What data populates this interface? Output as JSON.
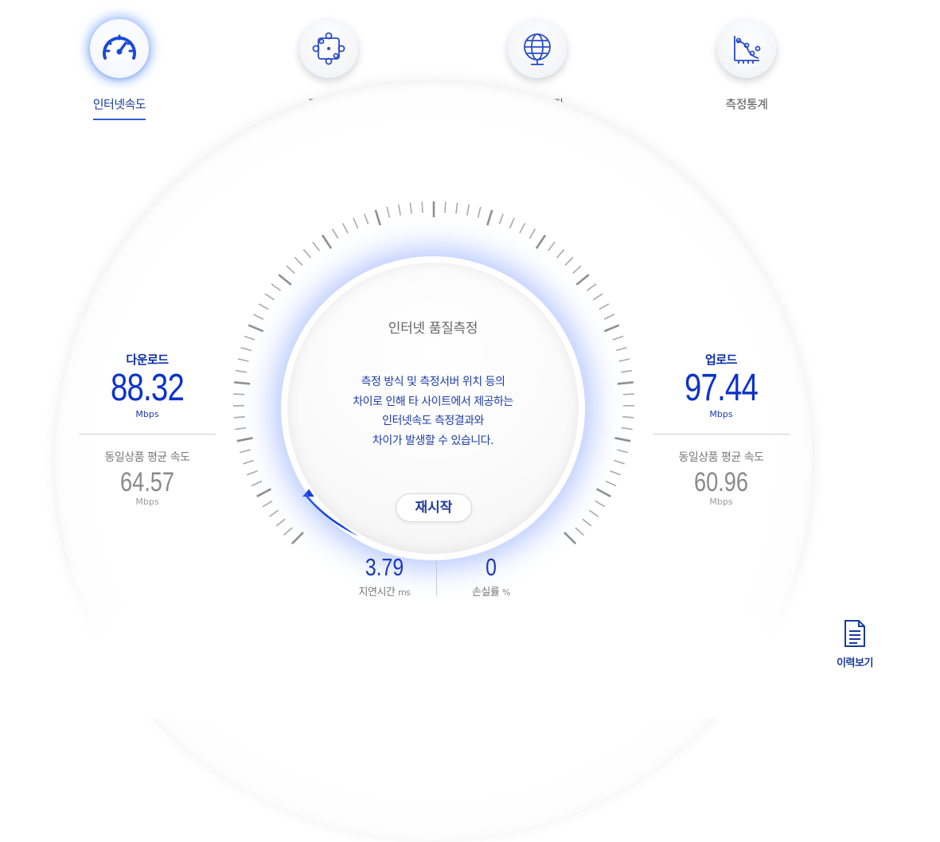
{
  "nav": {
    "items": [
      {
        "label": "인터넷속도",
        "icon": "speedometer-icon",
        "active": true
      },
      {
        "label": "경로추적",
        "icon": "route-trace-icon",
        "active": false
      },
      {
        "label": "웹접속시간",
        "icon": "globe-icon",
        "active": false
      },
      {
        "label": "측정통계",
        "icon": "statistics-chart-icon",
        "active": false
      }
    ]
  },
  "meter": {
    "title": "인터넷 품질측정",
    "notice": [
      "측정 방식 및 측정서버 위치 등의",
      "차이로 인해 타 사이트에서 제공하는",
      "인터넷속도 측정결과와",
      "차이가 발생할 수 있습니다."
    ],
    "restart_label": "재시작"
  },
  "download": {
    "title": "다운로드",
    "value": "88.32",
    "unit": "Mbps",
    "avg_title": "동일상품 평균 속도",
    "avg_value": "64.57",
    "avg_unit": "Mbps"
  },
  "upload": {
    "title": "업로드",
    "value": "97.44",
    "unit": "Mbps",
    "avg_title": "동일상품 평균 속도",
    "avg_value": "60.96",
    "avg_unit": "Mbps"
  },
  "latency": {
    "value": "3.79",
    "label": "지연시간",
    "unit": "ms"
  },
  "loss": {
    "value": "0",
    "label": "손실률",
    "unit": "%"
  },
  "history": {
    "label": "이력보기",
    "icon": "document-icon"
  },
  "colors": {
    "accent": "#0d33c8",
    "accent_dark": "#1a3a9a",
    "glow": "#5a82ff",
    "muted": "#8a8a8a"
  }
}
